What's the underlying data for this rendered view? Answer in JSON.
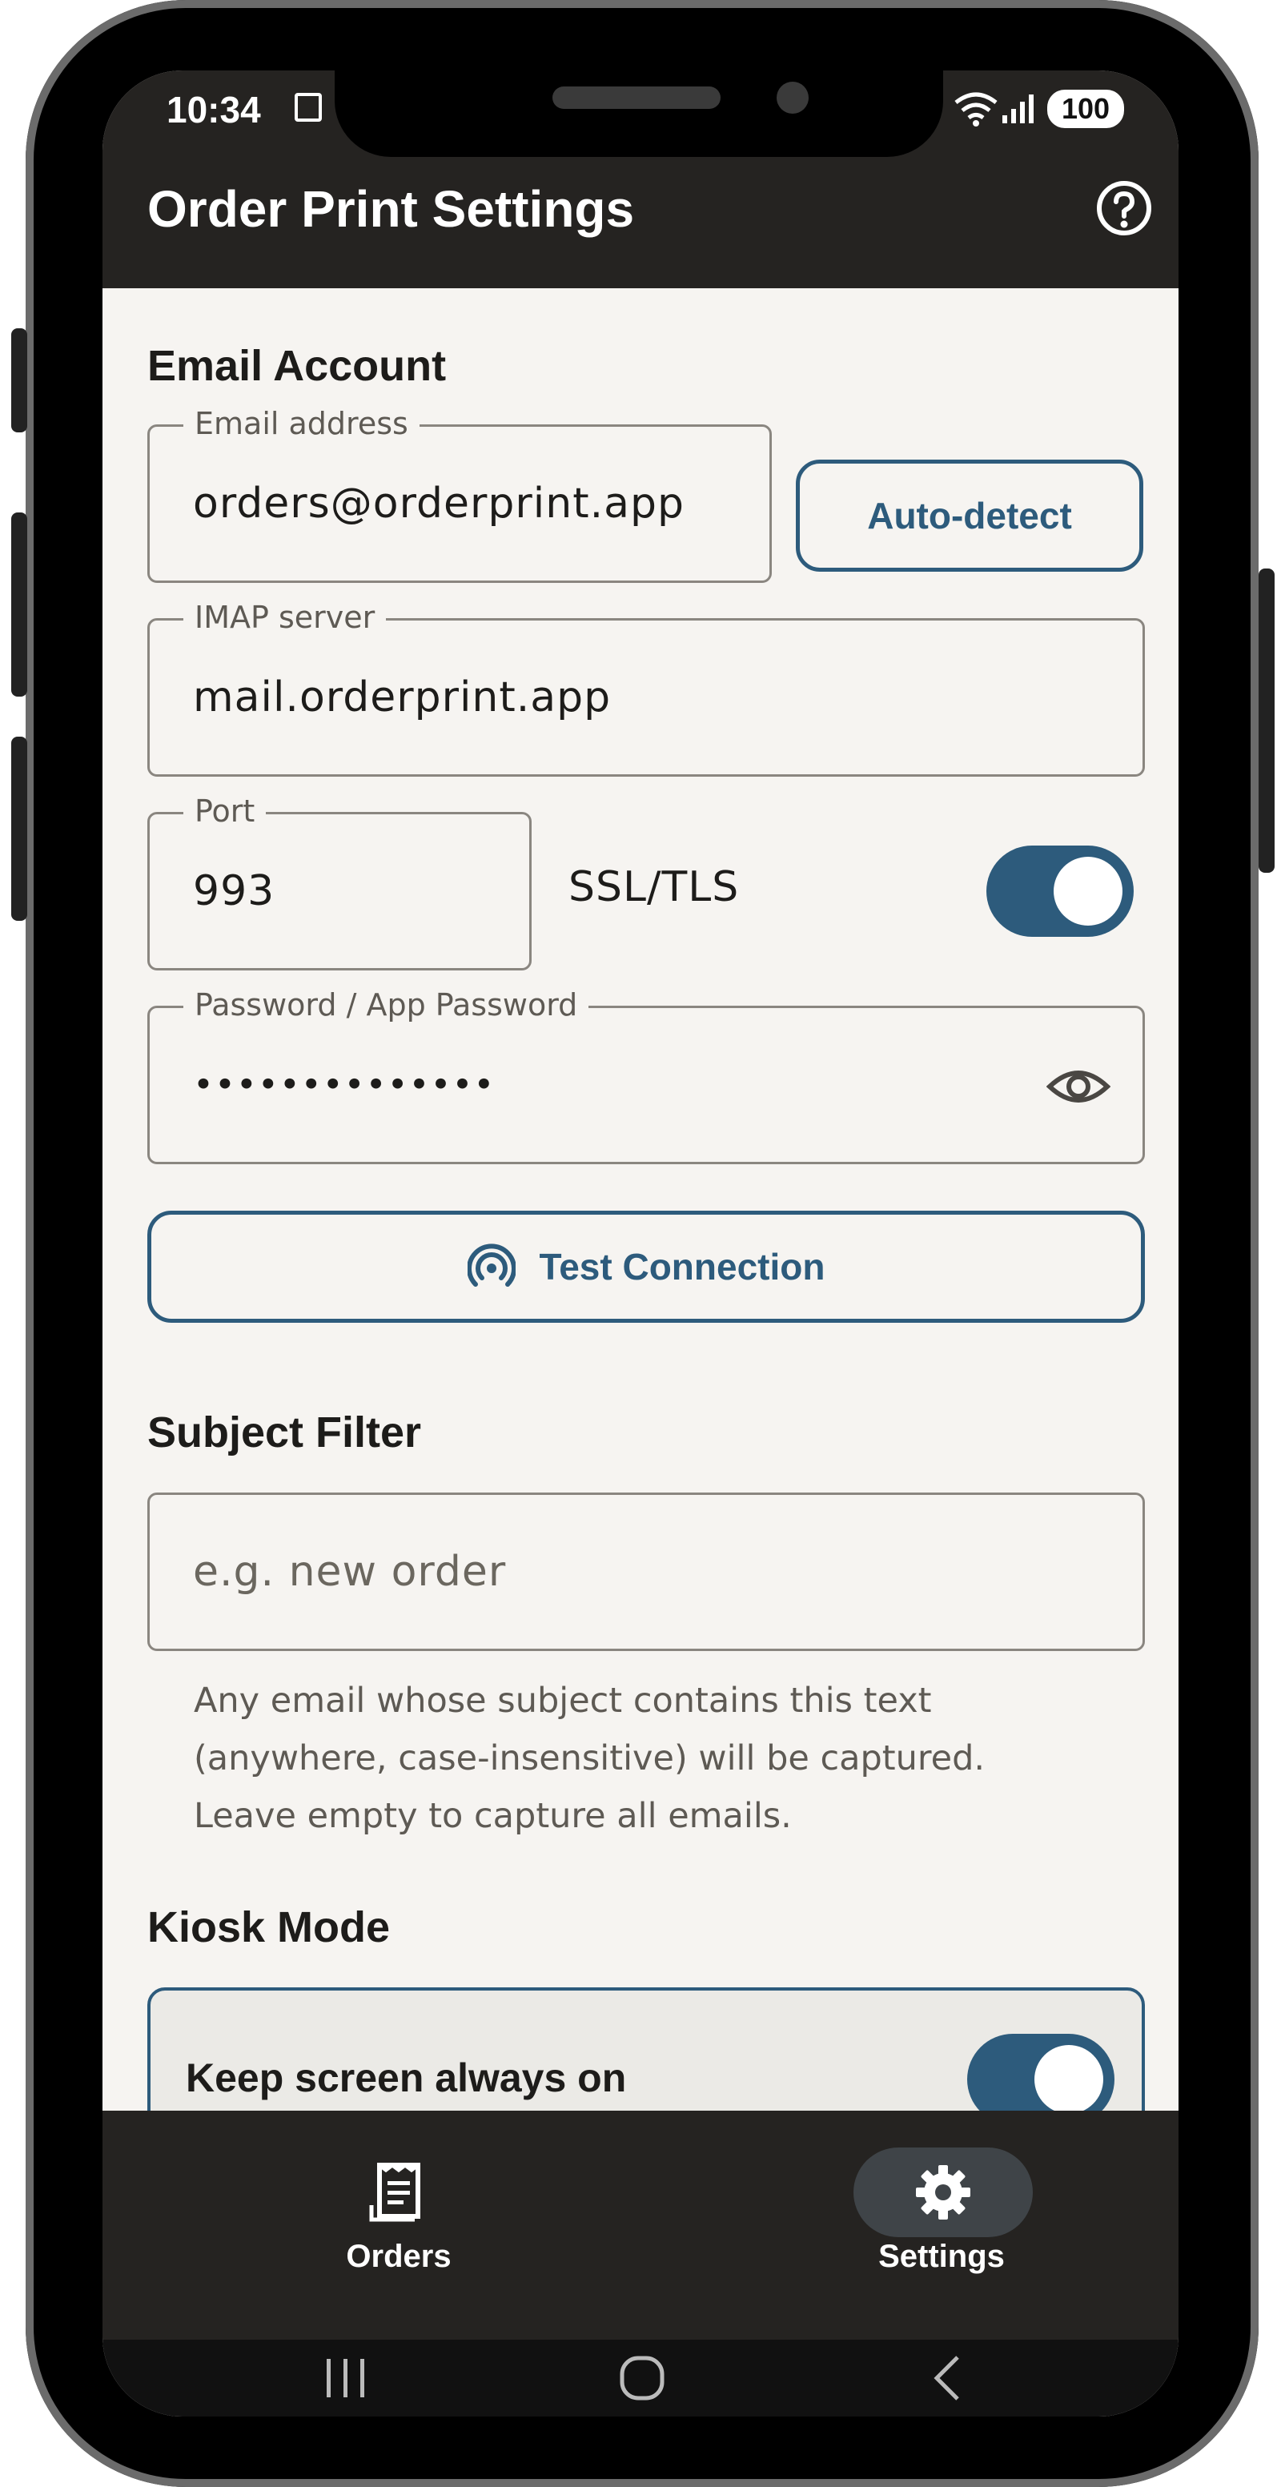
{
  "status_bar": {
    "time": "10:34",
    "battery": "100"
  },
  "app_bar": {
    "title": "Order Print Settings",
    "help_icon": "help-circle-icon"
  },
  "email_account": {
    "title": "Email Account",
    "email_label": "Email address",
    "email_value": "orders@orderprint.app",
    "auto_detect_label": "Auto-detect",
    "imap_label": "IMAP server",
    "imap_value": "mail.orderprint.app",
    "port_label": "Port",
    "port_value": "993",
    "ssl_label": "SSL/TLS",
    "ssl_enabled": true,
    "password_label": "Password / App Password",
    "password_value": "••••••••••••••",
    "test_connection_label": "Test Connection"
  },
  "subject_filter": {
    "title": "Subject Filter",
    "placeholder": "e.g. new order",
    "helper_lines": [
      "Any email whose subject contains this text",
      "(anywhere, case-insensitive) will be captured.",
      "Leave empty to capture all emails."
    ]
  },
  "kiosk_mode": {
    "title": "Kiosk Mode",
    "keep_screen_on_label": "Keep screen always on",
    "keep_screen_on_enabled": true
  },
  "bottom_nav": {
    "items": [
      {
        "label": "Orders",
        "icon": "receipt-icon"
      },
      {
        "label": "Settings",
        "icon": "gear-icon",
        "active": true
      }
    ]
  },
  "colors": {
    "accent": "#2d5b7c",
    "bar": "#252321",
    "background": "#f6f4f1"
  }
}
